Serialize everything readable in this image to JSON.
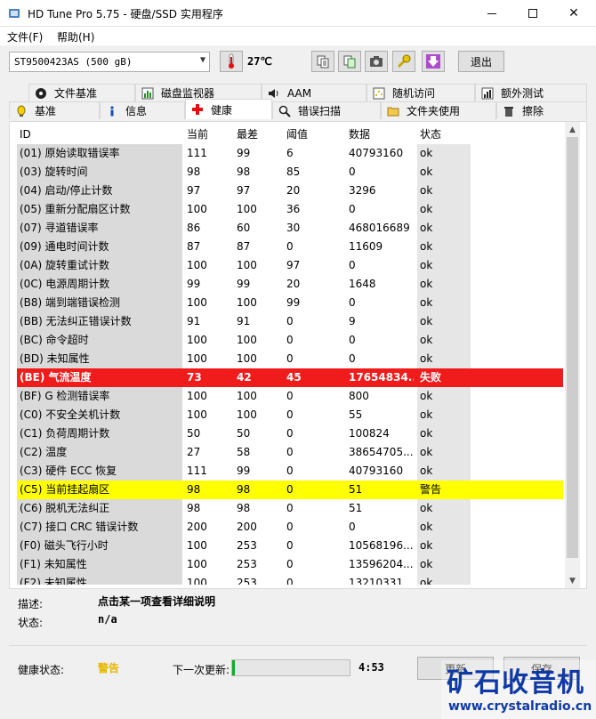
{
  "window": {
    "title": "HD Tune Pro 5.75 - 硬盘/SSD 实用程序"
  },
  "menu": {
    "file": "文件(F)",
    "help": "帮助(H)"
  },
  "toolbar": {
    "drive": "ST9500423AS (500 gB)",
    "temperature": "27℃",
    "exit_label": "退出"
  },
  "tabs": {
    "top": [
      "文件基准",
      "磁盘监视器",
      "AAM",
      "随机访问",
      "额外测试"
    ],
    "bottom": [
      "基准",
      "信息",
      "健康",
      "错误扫描",
      "文件夹使用",
      "擦除"
    ],
    "active": "健康"
  },
  "table": {
    "headers": [
      "ID",
      "当前",
      "最差",
      "阈值",
      "数据",
      "状态"
    ],
    "rows": [
      [
        "(01) 原始读取错误率",
        "111",
        "99",
        "6",
        "40793160",
        "ok"
      ],
      [
        "(03) 旋转时间",
        "98",
        "98",
        "85",
        "0",
        "ok"
      ],
      [
        "(04) 启动/停止计数",
        "97",
        "97",
        "20",
        "3296",
        "ok"
      ],
      [
        "(05) 重新分配扇区计数",
        "100",
        "100",
        "36",
        "0",
        "ok"
      ],
      [
        "(07) 寻道错误率",
        "86",
        "60",
        "30",
        "468016689",
        "ok"
      ],
      [
        "(09) 通电时间计数",
        "87",
        "87",
        "0",
        "11609",
        "ok"
      ],
      [
        "(0A) 旋转重试计数",
        "100",
        "100",
        "97",
        "0",
        "ok"
      ],
      [
        "(0C) 电源周期计数",
        "99",
        "99",
        "20",
        "1648",
        "ok"
      ],
      [
        "(B8) 端到端错误检测",
        "100",
        "100",
        "99",
        "0",
        "ok"
      ],
      [
        "(BB) 无法纠正错误计数",
        "91",
        "91",
        "0",
        "9",
        "ok"
      ],
      [
        "(BC) 命令超时",
        "100",
        "100",
        "0",
        "0",
        "ok"
      ],
      [
        "(BD) 未知属性",
        "100",
        "100",
        "0",
        "0",
        "ok"
      ],
      [
        "(BE) 气流温度",
        "73",
        "42",
        "45",
        "17654834...",
        "失败"
      ],
      [
        "(BF) G 检测错误率",
        "100",
        "100",
        "0",
        "800",
        "ok"
      ],
      [
        "(C0) 不安全关机计数",
        "100",
        "100",
        "0",
        "55",
        "ok"
      ],
      [
        "(C1) 负荷周期计数",
        "50",
        "50",
        "0",
        "100824",
        "ok"
      ],
      [
        "(C2) 温度",
        "27",
        "58",
        "0",
        "38654705...",
        "ok"
      ],
      [
        "(C3) 硬件 ECC 恢复",
        "111",
        "99",
        "0",
        "40793160",
        "ok"
      ],
      [
        "(C5) 当前挂起扇区",
        "98",
        "98",
        "0",
        "51",
        "警告"
      ],
      [
        "(C6) 脱机无法纠正",
        "98",
        "98",
        "0",
        "51",
        "ok"
      ],
      [
        "(C7) 接口 CRC 错误计数",
        "200",
        "200",
        "0",
        "0",
        "ok"
      ],
      [
        "(F0) 磁头飞行小时",
        "100",
        "253",
        "0",
        "10568196...",
        "ok"
      ],
      [
        "(F1) 未知属性",
        "100",
        "253",
        "0",
        "13596204...",
        "ok"
      ],
      [
        "(F2) 未知属性",
        "100",
        "253",
        "0",
        "13210331...",
        "ok"
      ]
    ],
    "fail_row": 12,
    "warn_row": 18,
    "fail_color": "#f01c1c",
    "warn_color": "#ffff00"
  },
  "description": {
    "desc_label": "描述:",
    "desc_value": "点击某一项查看详细说明",
    "status_label": "状态:",
    "status_value": "n/a"
  },
  "bottom": {
    "health_label": "健康状态:",
    "health_value": "警告",
    "health_color": "#e6b800",
    "next_update_label": "下一次更新:",
    "next_update_progress": 0.02,
    "next_update_time": "4:53",
    "refresh_label": "更新",
    "save_label": "保存"
  },
  "watermark": {
    "name": "矿石收音机",
    "url": "www.crystalradio.cn"
  }
}
